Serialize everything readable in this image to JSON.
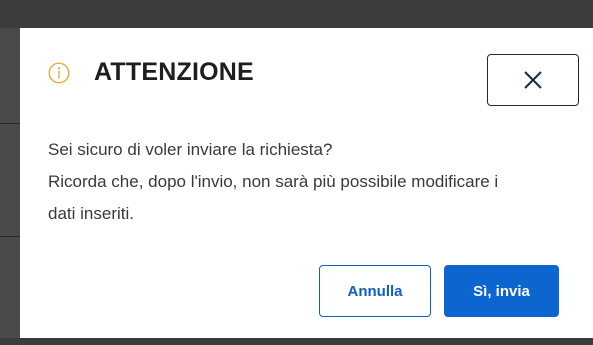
{
  "colors": {
    "backdrop": "#3c3c3c",
    "info_icon": "#f0a83a",
    "primary": "#0d66d0",
    "title": "#1e1e1e",
    "body_text": "#3a3a3a"
  },
  "dialog": {
    "title": "ATTENZIONE",
    "icon": "info-icon",
    "close_icon": "close-icon",
    "message_lines": [
      "Sei sicuro di voler inviare la richiesta?",
      "Ricorda che, dopo l'invio, non sarà più possibile modificare i",
      "dati inseriti."
    ],
    "buttons": {
      "cancel_label": "Annulla",
      "confirm_label": "Sì, invia"
    }
  }
}
